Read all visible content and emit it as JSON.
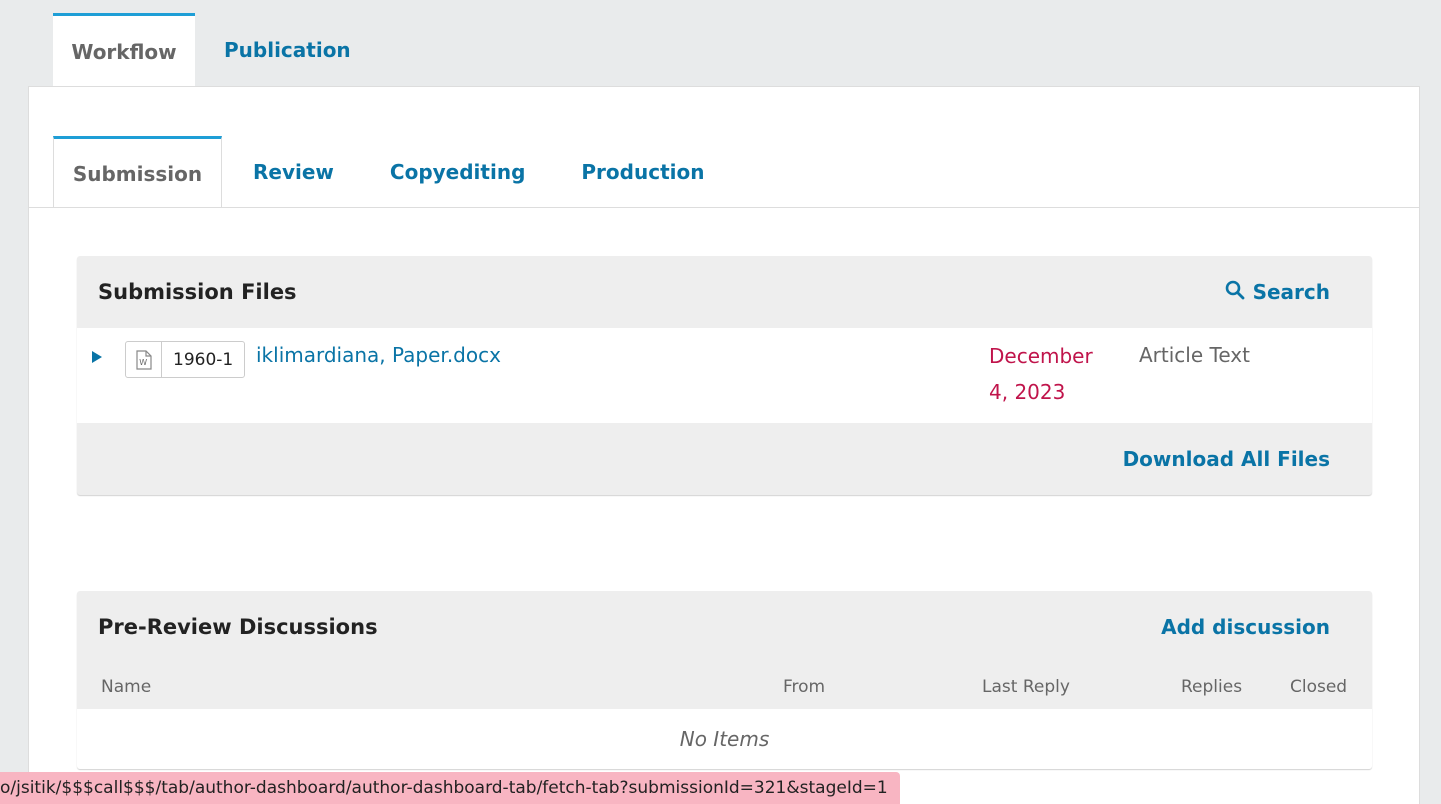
{
  "top_tabs": {
    "workflow": "Workflow",
    "publication": "Publication"
  },
  "stage_tabs": {
    "submission": "Submission",
    "review": "Review",
    "copyediting": "Copyediting",
    "production": "Production"
  },
  "submission_files": {
    "title": "Submission Files",
    "search_label": "Search",
    "file": {
      "id": "1960-1",
      "name": "iklimardiana, Paper.docx",
      "date_line1": "December",
      "date_line2": "4, 2023",
      "type": "Article Text",
      "icon": "word-file-icon"
    },
    "download_label": "Download All Files"
  },
  "discussions": {
    "title": "Pre-Review Discussions",
    "add_label": "Add discussion",
    "columns": [
      "Name",
      "From",
      "Last Reply",
      "Replies",
      "Closed"
    ],
    "empty_text": "No Items"
  },
  "status_bar": {
    "url": "o/jsitik/$$$call$$$/tab/author-dashboard/author-dashboard-tab/fetch-tab?submissionId=321&stageId=1"
  },
  "colors": {
    "accent": "#0a74a6",
    "tab_border": "#1e9ed6",
    "date": "#c0144b",
    "status_bg": "#f8b5c2"
  }
}
